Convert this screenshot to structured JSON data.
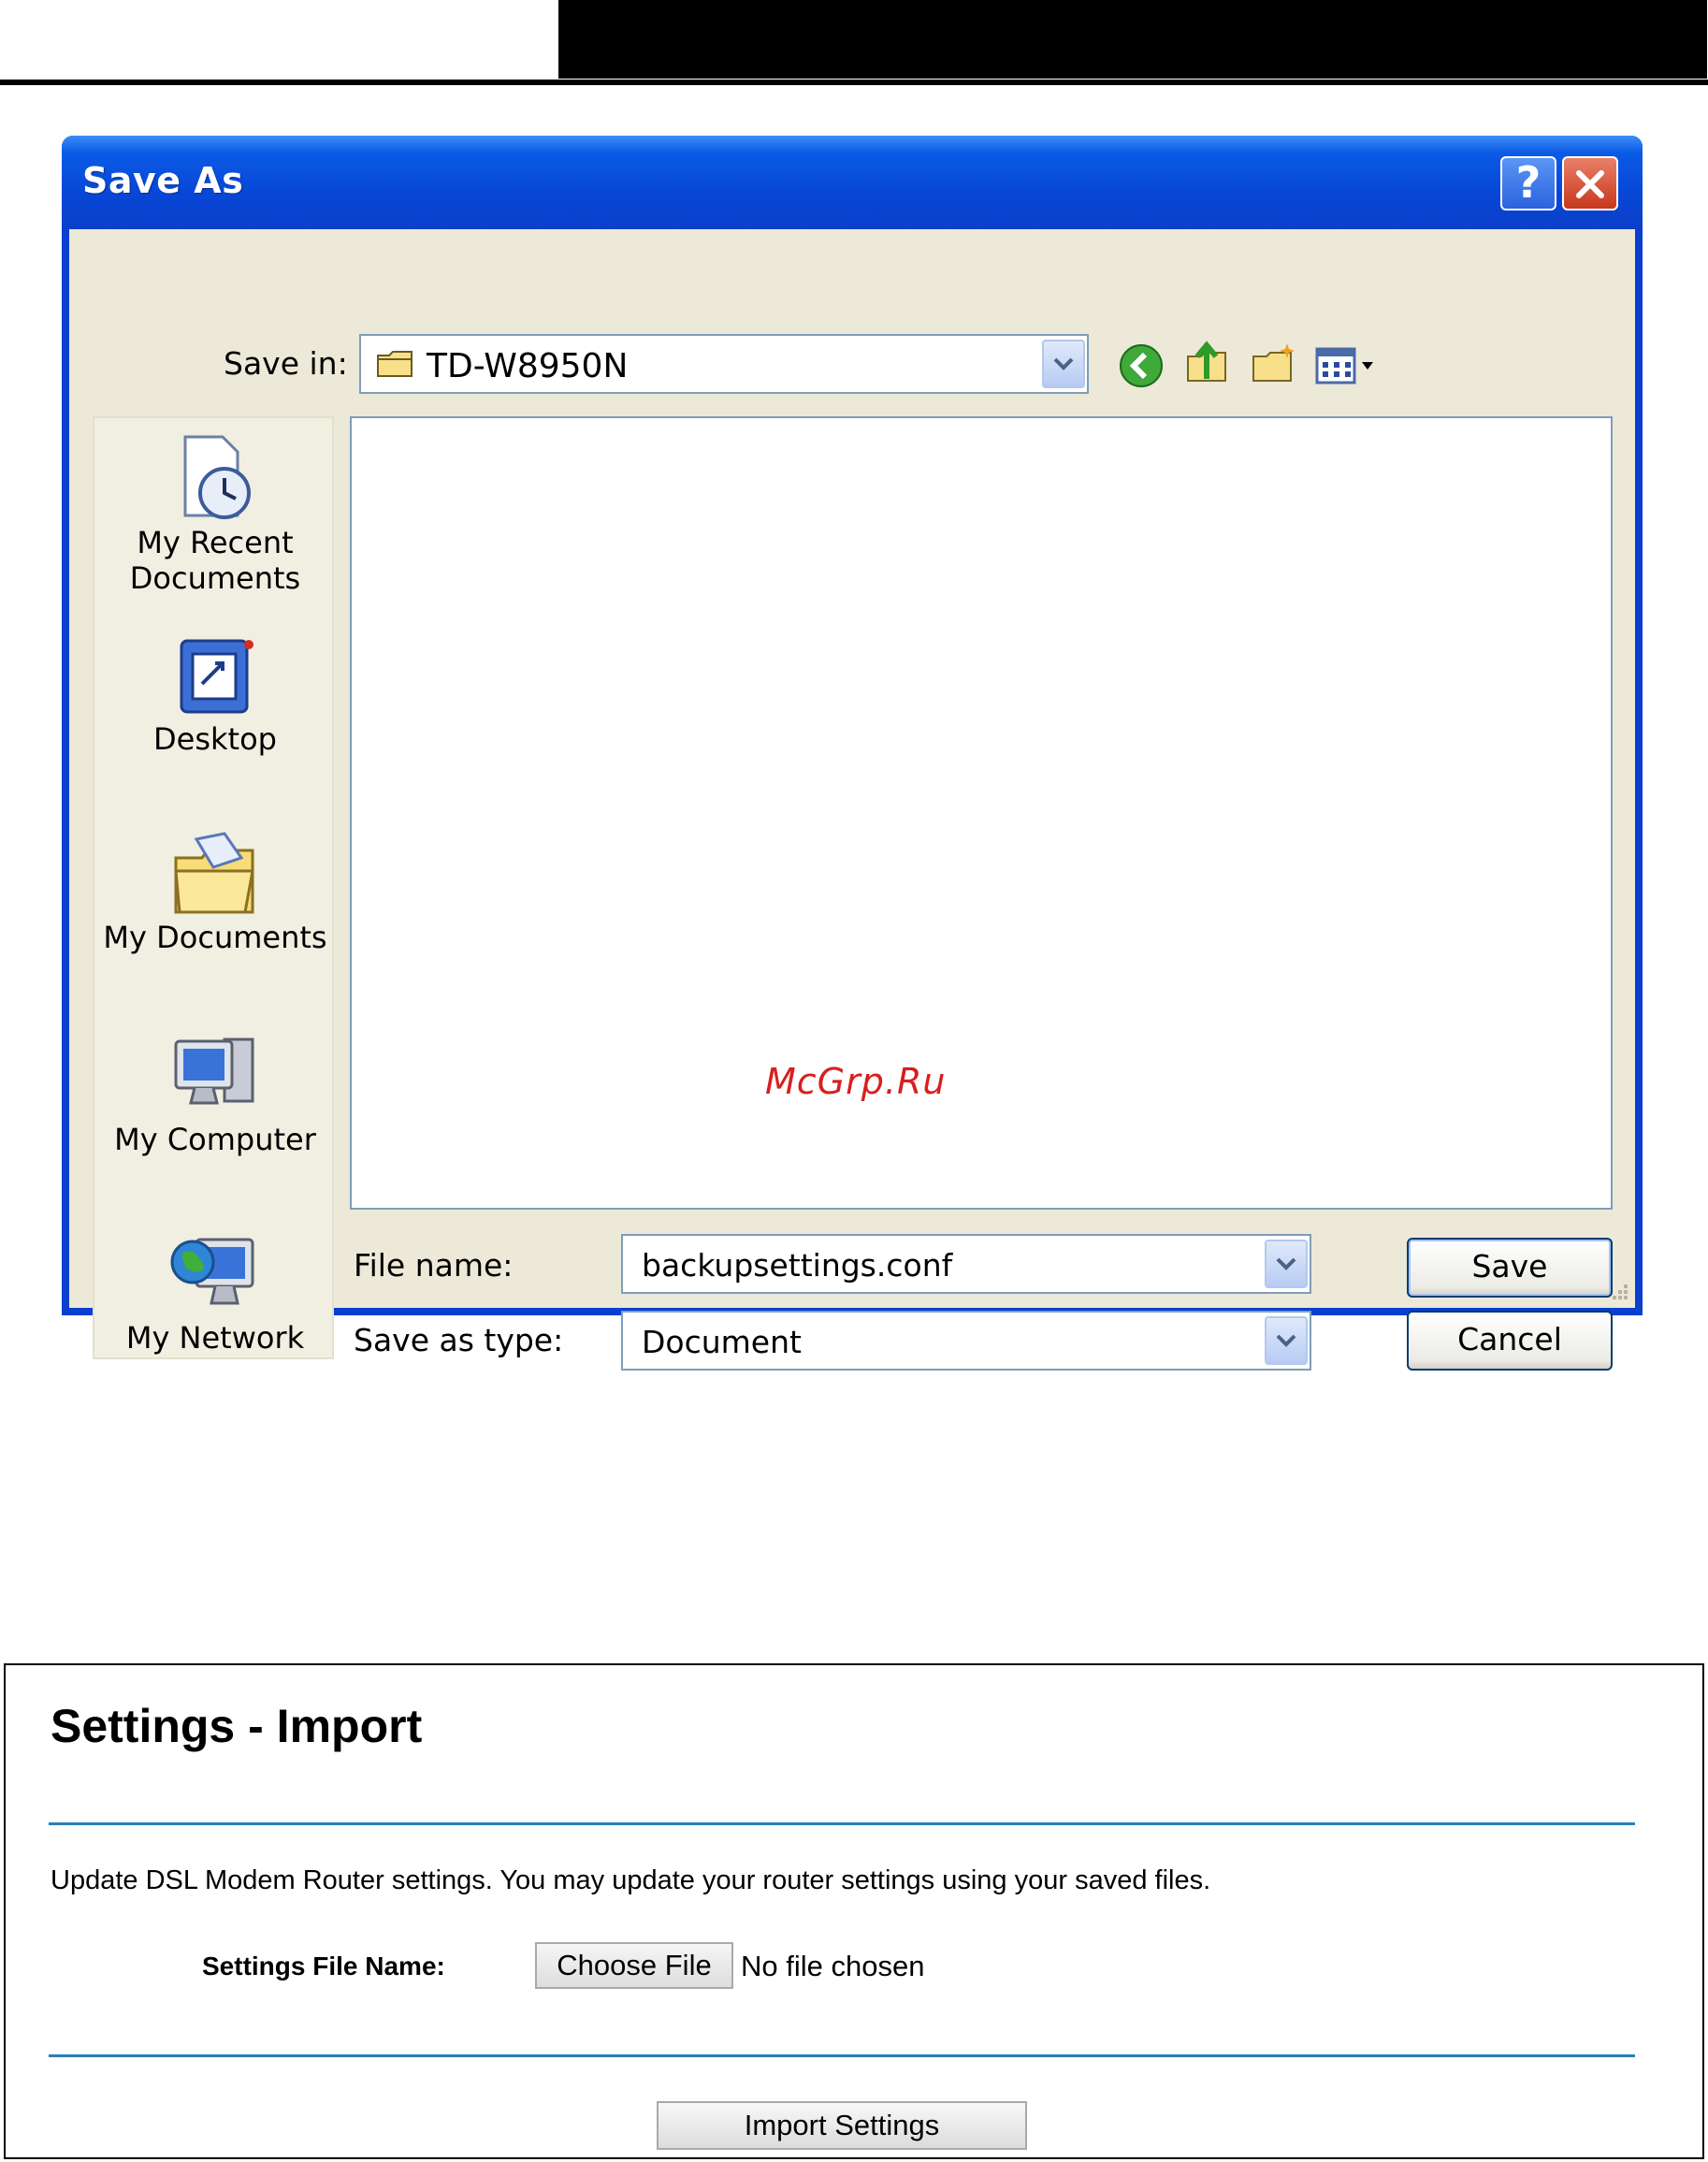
{
  "dialog": {
    "title": "Save As",
    "help_glyph": "?",
    "close_glyph": "✕",
    "save_in_label": "Save in:",
    "save_in_value": "TD-W8950N",
    "file_name_label": "File name:",
    "file_name_value": "backupsettings.conf",
    "save_type_label": "Save as type:",
    "save_type_value": "Document",
    "save_button": "Save",
    "cancel_button": "Cancel",
    "places": [
      {
        "label_line1": "My Recent",
        "label_line2": "Documents",
        "icon": "recent-documents-icon"
      },
      {
        "label_line1": "Desktop",
        "label_line2": "",
        "icon": "desktop-icon"
      },
      {
        "label_line1": "My Documents",
        "label_line2": "",
        "icon": "my-documents-icon"
      },
      {
        "label_line1": "My Computer",
        "label_line2": "",
        "icon": "my-computer-icon"
      },
      {
        "label_line1": "My Network",
        "label_line2": "",
        "icon": "my-network-icon"
      }
    ],
    "toolbar_icons": [
      "back-icon",
      "up-folder-icon",
      "new-folder-icon",
      "views-menu-icon"
    ]
  },
  "watermark": "McGrp.Ru",
  "import_panel": {
    "title": "Settings - Import",
    "description": "Update DSL Modem Router settings. You may update your router settings using your saved files.",
    "file_label": "Settings File Name:",
    "choose_button": "Choose File",
    "no_file_text": "No file chosen",
    "import_button": "Import Settings"
  },
  "colors": {
    "titlebar": "#0b5be6",
    "dialog_face": "#ece9d8",
    "rule_blue": "#2a7fb7",
    "watermark_red": "#d91e1e"
  }
}
